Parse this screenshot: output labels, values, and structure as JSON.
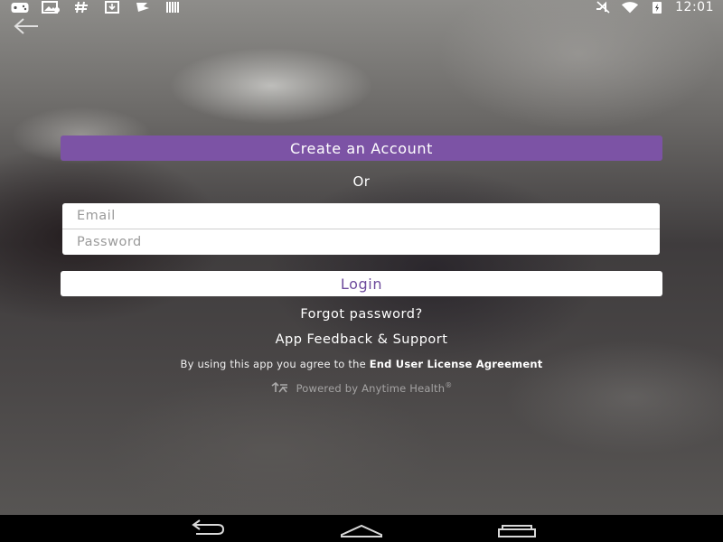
{
  "status_bar": {
    "time": "12:01",
    "left_icons": [
      "gamepad-icon",
      "image-icon",
      "hash-icon",
      "download-icon",
      "signal-flag-icon",
      "barcode-icon"
    ],
    "right_icons": [
      "mute-icon",
      "wifi-icon",
      "battery-icon"
    ]
  },
  "header": {
    "back_icon": "back-arrow-icon"
  },
  "main": {
    "create_account_label": "Create an Account",
    "or_label": "Or",
    "email_placeholder": "Email",
    "password_placeholder": "Password",
    "login_label": "Login",
    "forgot_password_label": "Forgot password?",
    "feedback_label": "App Feedback & Support",
    "eula_prefix": "By using this app you agree to the ",
    "eula_link": "End User License Agreement",
    "powered_by": "Powered by Anytime Health",
    "powered_by_mark": "®"
  },
  "nav_bar": {
    "icons": [
      "nav-back-icon",
      "nav-home-icon",
      "nav-recents-icon"
    ]
  },
  "colors": {
    "accent_purple": "#7c53a5",
    "login_text": "#6d4a9c"
  }
}
